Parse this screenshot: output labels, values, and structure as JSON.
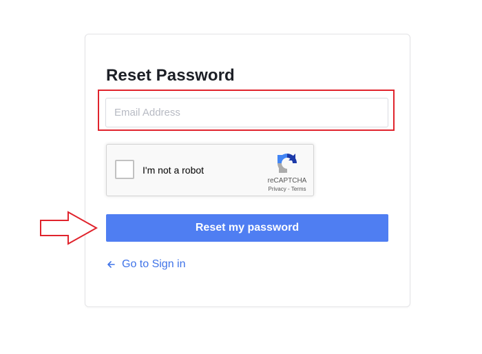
{
  "form": {
    "title": "Reset Password",
    "email_placeholder": "Email Address",
    "email_value": "",
    "submit_label": "Reset my password",
    "back_link": "Go to Sign in"
  },
  "recaptcha": {
    "label": "I'm not a robot",
    "brand": "reCAPTCHA",
    "privacy": "Privacy",
    "separator": " - ",
    "terms": "Terms",
    "checked": false
  },
  "annotations": {
    "highlight_color": "#e0232c",
    "arrow_color": "#e0232c"
  },
  "colors": {
    "primary": "#4f7ef2",
    "link": "#3f73e8",
    "title": "#1c1f26"
  }
}
